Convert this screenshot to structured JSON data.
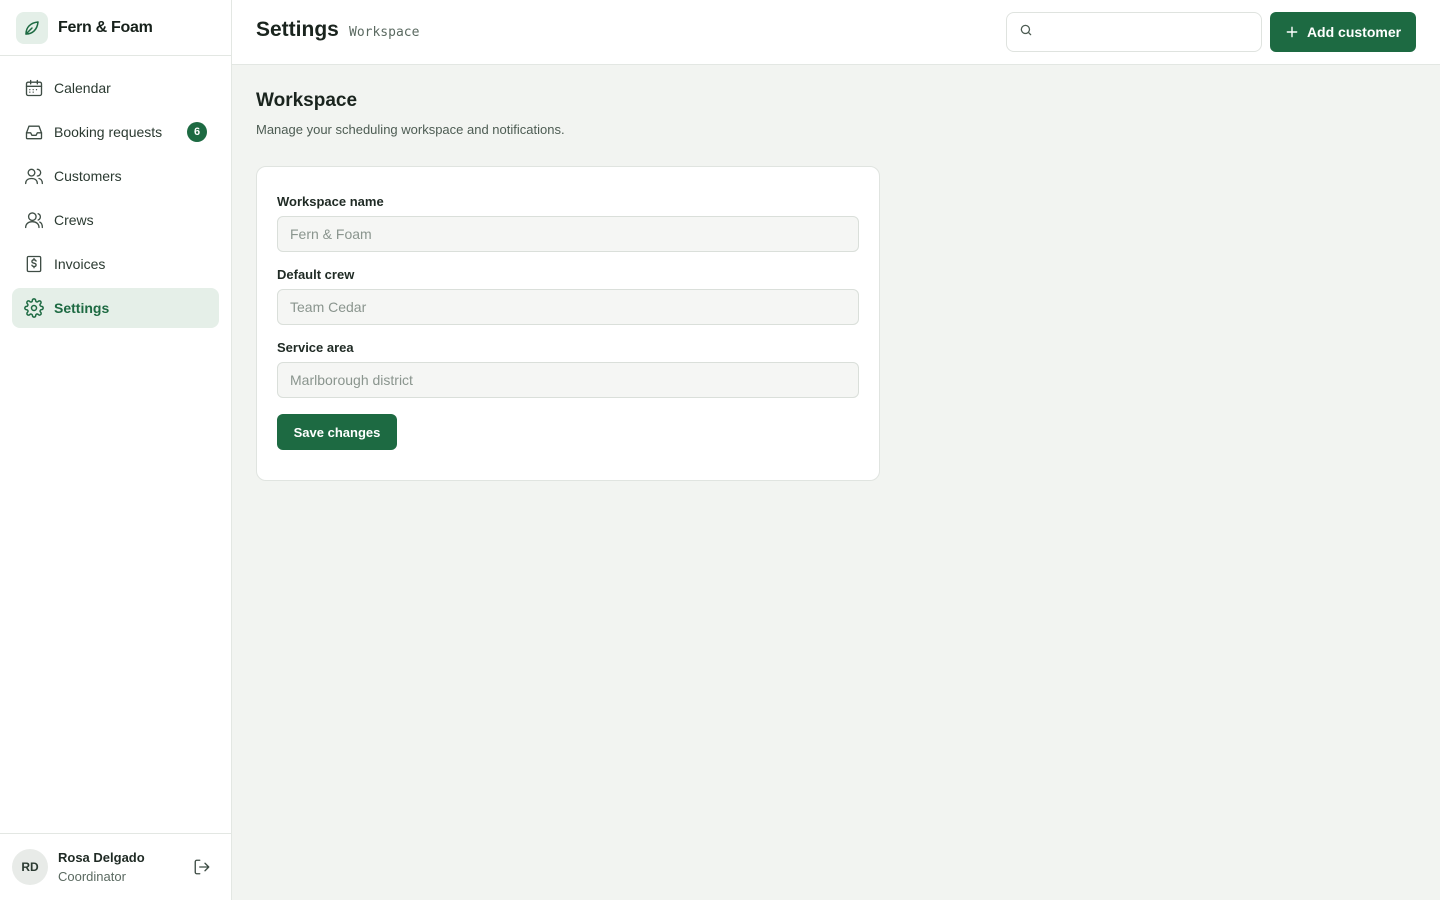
{
  "brand": {
    "name": "Fern & Foam",
    "icon": "leaf-icon"
  },
  "sidebar": {
    "items": [
      {
        "label": "Calendar",
        "icon": "calendar-icon",
        "active": false
      },
      {
        "label": "Booking requests",
        "icon": "inbox-icon",
        "active": false,
        "badge": "6"
      },
      {
        "label": "Customers",
        "icon": "users-icon",
        "active": false
      },
      {
        "label": "Crews",
        "icon": "crew-icon",
        "active": false
      },
      {
        "label": "Invoices",
        "icon": "receipt-icon",
        "active": false
      },
      {
        "label": "Settings",
        "icon": "gear-icon",
        "active": true
      }
    ]
  },
  "user": {
    "initials": "RD",
    "name": "Rosa Delgado",
    "role": "Coordinator"
  },
  "header": {
    "title": "Settings",
    "subtitle": "Workspace",
    "search_placeholder": "",
    "add_button_label": "Add customer"
  },
  "main": {
    "section_title": "Workspace",
    "section_desc": "Manage your scheduling workspace and notifications.",
    "form": {
      "workspace_name": {
        "label": "Workspace name",
        "placeholder": "Fern & Foam"
      },
      "default_crew": {
        "label": "Default crew",
        "placeholder": "Team Cedar"
      },
      "service_area": {
        "label": "Service area",
        "placeholder": "Marlborough district"
      },
      "save_label": "Save changes"
    }
  },
  "colors": {
    "accent": "#1d6a42",
    "active_bg": "#e5efe8",
    "page_bg": "#f2f4f1"
  }
}
